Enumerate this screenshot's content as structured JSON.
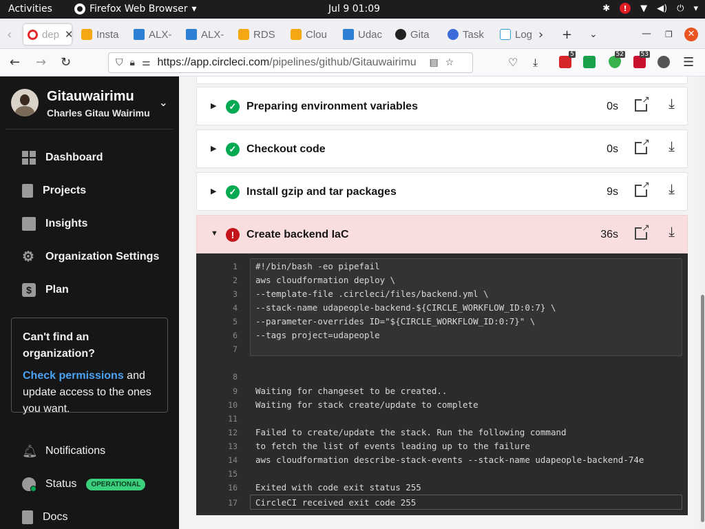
{
  "topbar": {
    "activities": "Activities",
    "app_name": "Firefox Web Browser",
    "clock": "Jul 9  01:09"
  },
  "tabs": [
    {
      "title": "dep",
      "favicon": "circleci-icon",
      "active": true
    },
    {
      "title": "Insta",
      "favicon": "aws-icon"
    },
    {
      "title": "ALX-",
      "favicon": "udacity-icon"
    },
    {
      "title": "ALX-",
      "favicon": "udacity-icon"
    },
    {
      "title": "RDS",
      "favicon": "aws-icon"
    },
    {
      "title": "Clou",
      "favicon": "aws-icon"
    },
    {
      "title": "Udac",
      "favicon": "udacity-icon"
    },
    {
      "title": "Gita",
      "favicon": "github-icon"
    },
    {
      "title": "Task",
      "favicon": "kubernetes-icon"
    },
    {
      "title": "Log",
      "favicon": "cisco-icon"
    }
  ],
  "navbar": {
    "url_host": "https://app.circleci.com",
    "url_path": "/pipelines/github/Gitauwairimu"
  },
  "extensions": [
    {
      "name": "ext-red-icon",
      "badge": "5",
      "color": "#d7262a"
    },
    {
      "name": "ext-green-icon",
      "badge": "",
      "color": "#17a24a"
    },
    {
      "name": "ext-shield-green-icon",
      "badge": "52",
      "color": "#37b24d"
    },
    {
      "name": "ext-ublock-icon",
      "badge": "53",
      "color": "#c8102e"
    }
  ],
  "sidebar": {
    "org_name": "Gitauwairimu",
    "user_name": "Charles Gitau Wairimu",
    "nav": {
      "dashboard": "Dashboard",
      "projects": "Projects",
      "insights": "Insights",
      "org_settings": "Organization Settings",
      "plan": "Plan",
      "notifications": "Notifications",
      "status": "Status",
      "status_badge": "OPERATIONAL",
      "docs": "Docs"
    },
    "org_box": {
      "heading": "Can't find an organization?",
      "link": "Check permissions",
      "text_after_link": " and update access to the ones you want."
    }
  },
  "steps": [
    {
      "title": "Preparing environment variables",
      "duration": "0s",
      "status": "success"
    },
    {
      "title": "Checkout code",
      "duration": "0s",
      "status": "success"
    },
    {
      "title": "Install gzip and tar packages",
      "duration": "9s",
      "status": "success"
    },
    {
      "title": "Create backend IaC",
      "duration": "36s",
      "status": "failed"
    }
  ],
  "console": {
    "lines": [
      {
        "n": "1",
        "t": "#!/bin/bash -eo pipefail"
      },
      {
        "n": "2",
        "t": "aws cloudformation deploy \\"
      },
      {
        "n": "3",
        "t": "--template-file .circleci/files/backend.yml \\"
      },
      {
        "n": "4",
        "t": "--stack-name udapeople-backend-${CIRCLE_WORKFLOW_ID:0:7} \\"
      },
      {
        "n": "5",
        "t": "--parameter-overrides ID=\"${CIRCLE_WORKFLOW_ID:0:7}\" \\"
      },
      {
        "n": "6",
        "t": "--tags project=udapeople"
      },
      {
        "n": "7",
        "t": ""
      },
      {
        "n": "8",
        "t": ""
      },
      {
        "n": "9",
        "t": "Waiting for changeset to be created.."
      },
      {
        "n": "10",
        "t": "Waiting for stack create/update to complete"
      },
      {
        "n": "11",
        "t": ""
      },
      {
        "n": "12",
        "t": "Failed to create/update the stack. Run the following command"
      },
      {
        "n": "13",
        "t": "to fetch the list of events leading up to the failure"
      },
      {
        "n": "14",
        "t": "aws cloudformation describe-stack-events --stack-name udapeople-backend-74e"
      },
      {
        "n": "15",
        "t": ""
      },
      {
        "n": "16",
        "t": "Exited with code exit status 255"
      },
      {
        "n": "17",
        "t": "CircleCI received exit code 255"
      }
    ]
  }
}
